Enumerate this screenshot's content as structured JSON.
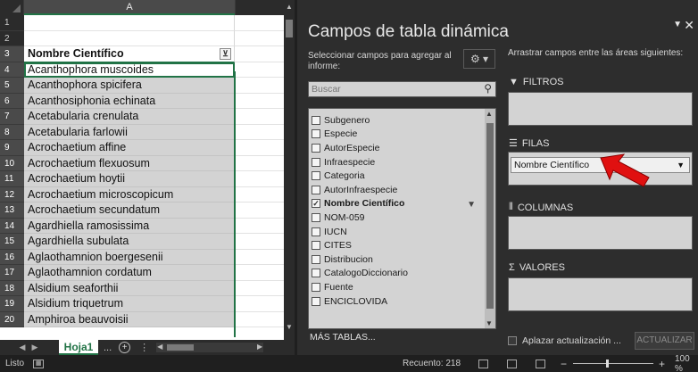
{
  "sheet": {
    "column_label": "A",
    "row_numbers": [
      "1",
      "2",
      "3",
      "4",
      "5",
      "6",
      "7",
      "8",
      "9",
      "10",
      "11",
      "12",
      "13",
      "14",
      "15",
      "16",
      "17",
      "18",
      "19",
      "20"
    ],
    "header": "Nombre Científico",
    "filter_glyph": "⊻",
    "rows": [
      "Acanthophora muscoides",
      "Acanthophora spicifera",
      "Acanthosiphonia echinata",
      "Acetabularia crenulata",
      "Acetabularia farlowii",
      "Acrochaetium affine",
      "Acrochaetium flexuosum",
      "Acrochaetium hoytii",
      "Acrochaetium microscopicum",
      "Acrochaetium secundatum",
      "Agardhiella ramosissima",
      "Agardhiella subulata",
      "Aglaothamnion boergesenii",
      "Aglaothamnion cordatum",
      "Alsidium seaforthii",
      "Alsidium triquetrum",
      "Amphiroa beauvoisii"
    ]
  },
  "tabs": {
    "sheet_name": "Hoja1",
    "more": "...",
    "add": "+",
    "dots": "⋮"
  },
  "pivot": {
    "title": "Campos de tabla dinámica",
    "choose_label": "Seleccionar campos para agregar al informe:",
    "gear": "⚙ ▾",
    "search_placeholder": "Buscar",
    "fields": [
      {
        "label": "Subgenero",
        "checked": false,
        "bold": false,
        "filtered": false
      },
      {
        "label": "Especie",
        "checked": false,
        "bold": false,
        "filtered": false
      },
      {
        "label": "AutorEspecie",
        "checked": false,
        "bold": false,
        "filtered": false
      },
      {
        "label": "Infraespecie",
        "checked": false,
        "bold": false,
        "filtered": false
      },
      {
        "label": "Categoria",
        "checked": false,
        "bold": false,
        "filtered": false
      },
      {
        "label": "AutorInfraespecie",
        "checked": false,
        "bold": false,
        "filtered": false
      },
      {
        "label": "Nombre Científico",
        "checked": true,
        "bold": true,
        "filtered": true
      },
      {
        "label": "NOM-059",
        "checked": false,
        "bold": false,
        "filtered": false
      },
      {
        "label": "IUCN",
        "checked": false,
        "bold": false,
        "filtered": false
      },
      {
        "label": "CITES",
        "checked": false,
        "bold": false,
        "filtered": false
      },
      {
        "label": "Distribucion",
        "checked": false,
        "bold": false,
        "filtered": false
      },
      {
        "label": "CatalogoDiccionario",
        "checked": false,
        "bold": false,
        "filtered": false
      },
      {
        "label": "Fuente",
        "checked": false,
        "bold": false,
        "filtered": false
      },
      {
        "label": "ENCICLOVIDA",
        "checked": false,
        "bold": false,
        "filtered": false
      }
    ],
    "more_tables": "MÁS TABLAS...",
    "drag_label": "Arrastrar campos entre las áreas siguientes:",
    "areas": {
      "filters": "FILTROS",
      "rows": "FILAS",
      "columns": "COLUMNAS",
      "values": "VALORES"
    },
    "rows_item": "Nombre Científico",
    "defer_label": "Aplazar actualización ...",
    "update_button": "ACTUALIZAR"
  },
  "status": {
    "ready": "Listo",
    "count": "Recuento: 218",
    "zoom": "100 %"
  },
  "colors": {
    "excel_green": "#217346",
    "arrow_red": "#e01010"
  }
}
